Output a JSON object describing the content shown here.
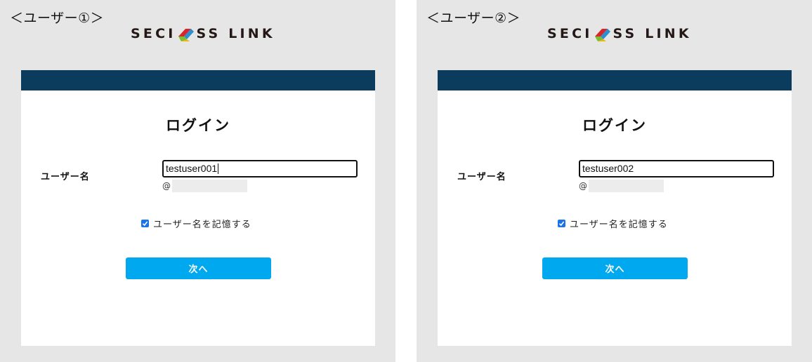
{
  "panels": [
    {
      "user_label": "＜ユーザー①＞",
      "logo_text_left": "SECI",
      "logo_text_right": "SS LINK",
      "login_title": "ログイン",
      "username_label": "ユーザー名",
      "username_value": "testuser001",
      "domain_prefix": "@",
      "remember_label": "ユーザー名を記憶する",
      "remember_checked": true,
      "next_label": "次へ"
    },
    {
      "user_label": "＜ユーザー②＞",
      "logo_text_left": "SECI",
      "logo_text_right": "SS LINK",
      "login_title": "ログイン",
      "username_label": "ユーザー名",
      "username_value": "testuser002",
      "domain_prefix": "@",
      "remember_label": "ユーザー名を記憶する",
      "remember_checked": true,
      "next_label": "次へ"
    }
  ],
  "colors": {
    "header": "#0b3c5d",
    "button": "#00a8ef",
    "checkbox": "#1a73e8",
    "background": "#e6e6e6"
  }
}
